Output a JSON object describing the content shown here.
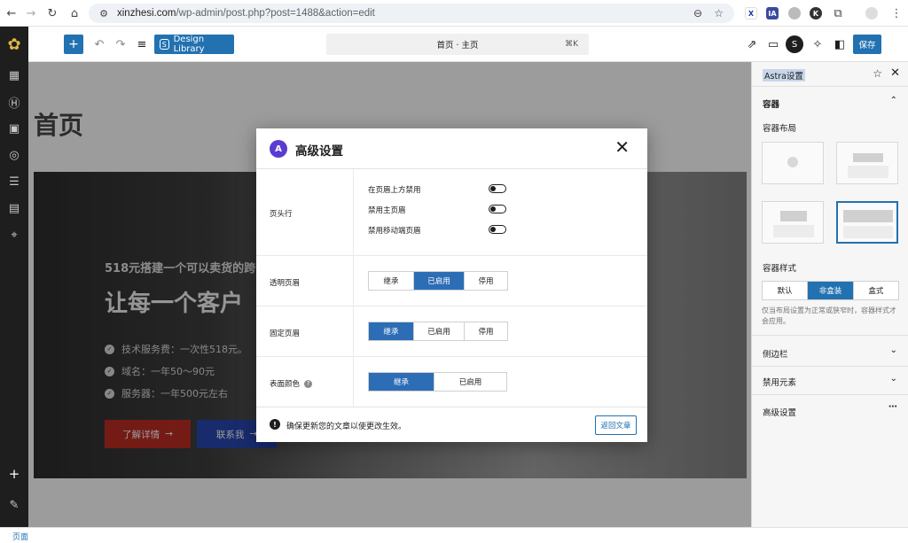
{
  "browser": {
    "url_host": "xinzhesi.com",
    "url_path": "/wp-admin/post.php?post=1488&action=edit",
    "extensions": [
      "X",
      "IA",
      "",
      "K",
      ""
    ]
  },
  "toolbar": {
    "design_library_label": "Design Library",
    "command_bar_text": "首页 · 主页",
    "command_shortcut": "⌘K",
    "save_label": "保存"
  },
  "canvas": {
    "page_title": "首页",
    "hero_subtitle": "518元搭建一个可以卖货的跨",
    "hero_title": "让每一个客户",
    "hero_items": [
      "技术服务费：一次性518元。",
      "域名：一年50～90元",
      "服务器：一年500元左右"
    ],
    "btn_details": "了解详情",
    "btn_contact": "联系我"
  },
  "sidebar": {
    "header": "Astra设置",
    "section_container": "容器",
    "container_layout_label": "容器布局",
    "container_style_label": "容器样式",
    "style_options": [
      "默认",
      "非盒装",
      "盒式"
    ],
    "style_selected": "非盒装",
    "style_note": "仅当布局设置为正常或狭窄时，容器样式才会应用。",
    "section_sidebar": "侧边栏",
    "section_disable": "禁用元素",
    "section_advanced": "高级设置"
  },
  "modal": {
    "title": "高级设置",
    "header_row_label": "页头行",
    "toggles": [
      "在页眉上方禁用",
      "禁用主页眉",
      "禁用移动端页眉"
    ],
    "transparent_label": "透明页眉",
    "transparent_options": [
      "继承",
      "已启用",
      "停用"
    ],
    "transparent_selected": "已启用",
    "sticky_label": "固定页眉",
    "sticky_options": [
      "继承",
      "已启用",
      "停用"
    ],
    "sticky_selected": "继承",
    "surface_label": "表面颜色",
    "surface_options": [
      "继承",
      "已启用"
    ],
    "surface_selected": "继承",
    "footer_note": "确保更新您的文章以使更改生效。",
    "back_button": "返回文章"
  },
  "footer": {
    "label": "页面"
  }
}
